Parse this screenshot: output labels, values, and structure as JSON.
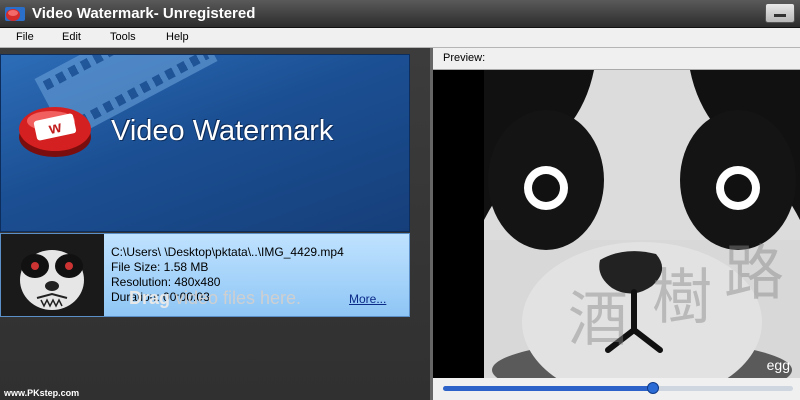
{
  "window": {
    "title": "Video Watermark- Unregistered"
  },
  "menu": {
    "items": [
      "File",
      "Edit",
      "Tools",
      "Help"
    ]
  },
  "banner": {
    "title": "Video Watermark",
    "logo_letter": "w"
  },
  "file": {
    "path": "C:\\Users\\          \\Desktop\\pktata\\..\\IMG_4429.mp4",
    "size": "File Size: 1.58 MB",
    "resolution": "Resolution: 480x480",
    "duration": "Duration: 00:00:03",
    "more": "More..."
  },
  "drag": {
    "bold": "Drag",
    "rest": " video files here."
  },
  "site_watermark": "www.PKstep.com",
  "preview": {
    "label": "Preview:",
    "corner_text": "egg",
    "progress": 0.6
  },
  "colors": {
    "banner_blue": "#1b4f93",
    "card_blue": "#9fd0fb",
    "seek_blue": "#2d63c8"
  }
}
